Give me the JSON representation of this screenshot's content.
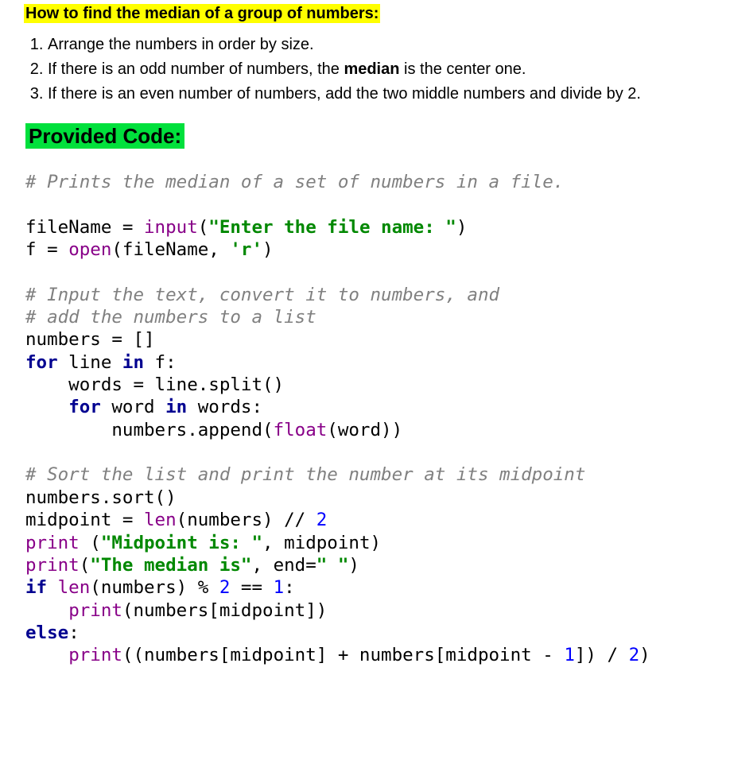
{
  "intro": {
    "heading": "How to find the median of a group of numbers:",
    "steps": [
      {
        "full": "Arrange the numbers in order by size."
      },
      {
        "pre": "If there is an odd number of numbers, the ",
        "bold": "median",
        "post": " is the center one."
      },
      {
        "full": "If there is an even number of numbers, add the two middle numbers and divide by 2."
      }
    ]
  },
  "section_heading": "Provided Code:",
  "code": {
    "c1": "# Prints the median of a set of numbers in a file.",
    "l1a": "fileName = ",
    "l1b": "input",
    "l1c": "(",
    "l1d": "\"Enter the file name: \"",
    "l1e": ")",
    "l2a": "f = ",
    "l2b": "open",
    "l2c": "(fileName, ",
    "l2d": "'r'",
    "l2e": ")",
    "c2": "# Input the text, convert it to numbers, and",
    "c3": "# add the numbers to a list",
    "l3": "numbers = []",
    "l4a": "for",
    "l4b": " line ",
    "l4c": "in",
    "l4d": " f:",
    "l5": "    words = line.split()",
    "l6a": "    ",
    "l6b": "for",
    "l6c": " word ",
    "l6d": "in",
    "l6e": " words:",
    "l7a": "        numbers.append(",
    "l7b": "float",
    "l7c": "(word))",
    "c4": "# Sort the list and print the number at its midpoint",
    "l8": "numbers.sort()",
    "l9a": "midpoint = ",
    "l9b": "len",
    "l9c": "(numbers) // ",
    "l9d": "2",
    "l10a": "print",
    "l10b": " (",
    "l10c": "\"Midpoint is: \"",
    "l10d": ", midpoint)",
    "l11a": "print",
    "l11b": "(",
    "l11c": "\"The median is\"",
    "l11d": ", end=",
    "l11e": "\" \"",
    "l11f": ")",
    "l12a": "if",
    "l12b": " ",
    "l12c": "len",
    "l12d": "(numbers) % ",
    "l12e": "2",
    "l12f": " == ",
    "l12g": "1",
    "l12h": ":",
    "l13a": "    ",
    "l13b": "print",
    "l13c": "(numbers[midpoint])",
    "l14a": "else",
    "l14b": ":",
    "l15a": "    ",
    "l15b": "print",
    "l15c": "((numbers[midpoint] + numbers[midpoint - ",
    "l15d": "1",
    "l15e": "]) / ",
    "l15f": "2",
    "l15g": ")"
  }
}
